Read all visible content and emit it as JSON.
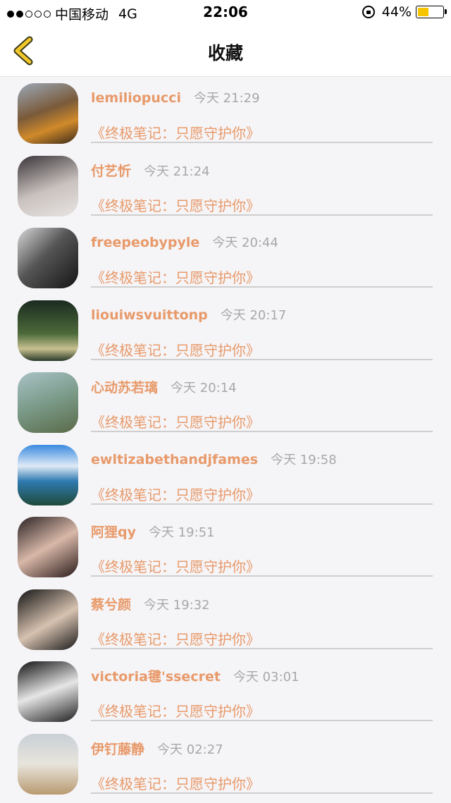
{
  "status_bar": {
    "carrier": "中国移动",
    "network": "4G",
    "time": "22:06",
    "battery": "44%",
    "battery_level": 0.44
  },
  "nav": {
    "title": "收藏",
    "back_icon": "chevron-left-icon"
  },
  "colors": {
    "accent": "#e89a6a",
    "time_gray": "#a8a8a8",
    "back_yellow": "#f3c82c",
    "battery_yellow": "#f7c500"
  },
  "items": [
    {
      "user": "lemiliopucci",
      "time": "今天 21:29",
      "work": "《终极笔记：只愿守护你》"
    },
    {
      "user": "付艺忻",
      "time": "今天 21:24",
      "work": "《终极笔记：只愿守护你》"
    },
    {
      "user": "freepeobypyle",
      "time": "今天 20:44",
      "work": "《终极笔记：只愿守护你》"
    },
    {
      "user": "liouiwsvuittonp",
      "time": "今天 20:17",
      "work": "《终极笔记：只愿守护你》"
    },
    {
      "user": "心动苏若璃",
      "time": "今天 20:14",
      "work": "《终极笔记：只愿守护你》"
    },
    {
      "user": "ewltizabethandjfames",
      "time": "今天 19:58",
      "work": "《终极笔记：只愿守护你》"
    },
    {
      "user": "阿狸qy",
      "time": "今天 19:51",
      "work": "《终极笔记：只愿守护你》"
    },
    {
      "user": "蔡兮颜",
      "time": "今天 19:32",
      "work": "《终极笔记：只愿守护你》"
    },
    {
      "user": "victoria毽'ssecret",
      "time": "今天 03:01",
      "work": "《终极笔记：只愿守护你》"
    },
    {
      "user": "伊钉藤静",
      "time": "今天 02:27",
      "work": "《终极笔记：只愿守护你》"
    }
  ]
}
